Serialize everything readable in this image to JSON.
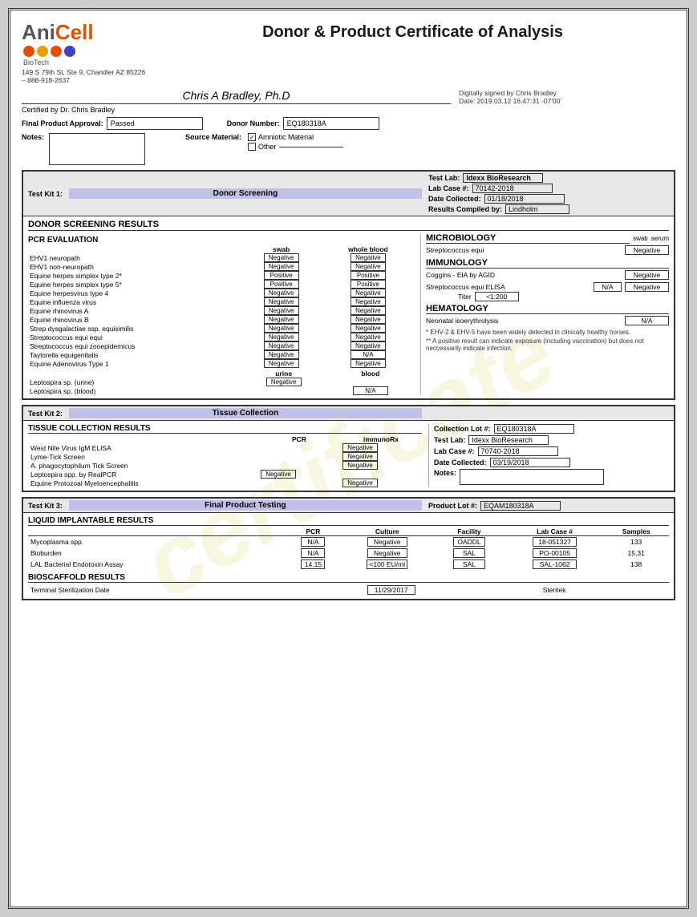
{
  "header": {
    "logo_ani": "Ani",
    "logo_cell": "Cell",
    "logo_biotech": "BioTech",
    "logo_address": "149 S 79th St, Ste 9, Chandler AZ 85226 – 888-918-2637",
    "title": "Donor & Product Certificate of Analysis",
    "digital_sig": "Digitally signed by Chris Bradley",
    "digital_date": "Date: 2019.03.12 16:47:31 -07'00'",
    "certified_by": "Certified by Dr. Chris Bradley"
  },
  "form": {
    "final_product_label": "Final Product Approval:",
    "final_product_value": "Passed",
    "donor_number_label": "Donor Number:",
    "donor_number_value": "EQ180318A",
    "notes_label": "Notes:",
    "source_material_label": "Source Material:",
    "source_amniotic": "Amniotic Material",
    "source_other": "Other"
  },
  "kit1": {
    "label": "Test Kit 1:",
    "title": "Donor Screening",
    "test_lab_label": "Test Lab:",
    "test_lab_value": "Idexx BioResearch",
    "lab_case_label": "Lab Case #:",
    "lab_case_value": "70142-2018",
    "date_collected_label": "Date Collected:",
    "date_collected_value": "01/18/2018",
    "compiled_label": "Results Compiled by:",
    "compiled_value": "Lindholm",
    "results_title": "DONOR SCREENING RESULTS",
    "pcr_title": "PCR EVALUATION",
    "col_swab": "swab",
    "col_whole_blood": "whole blood",
    "pcr_rows": [
      {
        "name": "EHV1 neuropath",
        "swab": "Negative",
        "blood": "Negative"
      },
      {
        "name": "EHV1 non-neuropath",
        "swab": "Negative",
        "blood": "Negative"
      },
      {
        "name": "Equine herpes simplex type 2*",
        "swab": "Positive",
        "blood": "Positive"
      },
      {
        "name": "Equine herpes simplex type 5*",
        "swab": "Positive",
        "blood": "Positive"
      },
      {
        "name": "Equine herpesvirus type 4",
        "swab": "Negative",
        "blood": "Negative"
      },
      {
        "name": "Equine influenza virus",
        "swab": "Negative",
        "blood": "Negative"
      },
      {
        "name": "Equine rhinovirus A",
        "swab": "Negative",
        "blood": "Negative"
      },
      {
        "name": "Equine rhinovirus B",
        "swab": "Negative",
        "blood": "Negative"
      },
      {
        "name": "Strep dysgalactiae ssp. equisimilis",
        "swab": "Negative",
        "blood": "Negative"
      },
      {
        "name": "Streptococcus equi equi",
        "swab": "Negative",
        "blood": "Negative"
      },
      {
        "name": "Streptococcus equi zooepidemicus",
        "swab": "Negative",
        "blood": "Negative"
      },
      {
        "name": "Taylorella equigenitalis",
        "swab": "Negative",
        "blood": "N/A"
      },
      {
        "name": "Equine Adenovirus Type 1",
        "swab": "Negative",
        "blood": "Negative"
      }
    ],
    "col_urine": "urine",
    "col_blood": "blood",
    "leptospira_rows": [
      {
        "name": "Leptospira sp. (urine)",
        "urine": "Negative",
        "blood": ""
      },
      {
        "name": "Leptospira sp. (blood)",
        "urine": "",
        "blood": "N/A"
      }
    ],
    "microbiology_title": "MICROBIOLOGY",
    "micro_col_swab": "swab",
    "micro_col_serum": "serum",
    "strep_equi_label": "Streptococcus equi",
    "strep_equi_swab": "Negative",
    "immunology_title": "IMMUNOLOGY",
    "coggins_label": "Coggins - EIA by AGID",
    "coggins_value": "Negative",
    "strep_elisa_label": "Streptococcus equi ELISA",
    "strep_elisa_col1": "N/A",
    "strep_elisa_col2": "Negative",
    "titer_label": "Titer",
    "titer_value": "<1:200",
    "hematology_title": "HEMATOLOGY",
    "neonatal_label": "Neonatal isoerythrolysis",
    "neonatal_value": "N/A",
    "footnote1": "* EHV-2 & EHV-5 have been widely detected in clinically healthy horses.",
    "footnote2": "** A positive result can indicate exposure (including vaccination) but does not neccessarily indicate infection."
  },
  "kit2": {
    "label": "Test Kit 2:",
    "title": "Tissue Collection",
    "results_title": "TISSUE COLLECTION RESULTS",
    "col_pcr": "PCR",
    "col_immunorx": "immunoRx",
    "tc_rows": [
      {
        "name": "West Nile Virus IgM ELISA",
        "pcr": "",
        "immunorx": "Negative"
      },
      {
        "name": "Lyme-Tick Screen",
        "pcr": "",
        "immunorx": "Negative"
      },
      {
        "name": "A. phagocytophilum Tick Screen",
        "pcr": "",
        "immunorx": "Negative"
      },
      {
        "name": "Leptospira spp. by RealPCR",
        "pcr": "Negative",
        "immunorx": ""
      },
      {
        "name": "Equine Protozoal Myeloencephalitis",
        "pcr": "",
        "immunorx": "Negative"
      }
    ],
    "collection_lot_label": "Collection Lot #:",
    "collection_lot_value": "EQ180318A",
    "test_lab_label": "Test Lab:",
    "test_lab_value": "Idexx BioResearch",
    "lab_case_label": "Lab Case #:",
    "lab_case_value": "70740-2018",
    "date_collected_label": "Date Collected:",
    "date_collected_value": "03/19/2018",
    "notes_label": "Notes:",
    "notes_value": ""
  },
  "kit3": {
    "label": "Test Kit 3:",
    "title": "Final Product Testing",
    "product_lot_label": "Product Lot #:",
    "product_lot_value": "EQAM180318A",
    "results_title": "LIQUID IMPLANTABLE RESULTS",
    "col_pcr": "PCR",
    "col_culture": "Culture",
    "col_facility": "Facility",
    "col_lab_case": "Lab Case #",
    "col_samples": "Samples",
    "fp_rows": [
      {
        "name": "Mycoplasma spp.",
        "pcr": "N/A",
        "culture": "Negative",
        "facility": "OADDL",
        "lab_case": "18-051327",
        "samples": "133"
      },
      {
        "name": "Bioburden",
        "pcr": "N/A",
        "culture": "Negative",
        "facility": "SAL",
        "lab_case": "PO-00105",
        "samples": "15,31"
      },
      {
        "name": "LAL Bacterial Endotoxin Assay",
        "pcr": "14.15",
        "culture": "<100 EU/ml",
        "facility": "SAL",
        "lab_case": "SAL-1062",
        "samples": "138"
      }
    ],
    "bioscaffold_title": "BIOSCAFFOLD RESULTS",
    "sterilization_label": "Terminal Sterilization Date",
    "sterilization_value": "11/29/2017",
    "sterilization_facility": "Steritek"
  }
}
